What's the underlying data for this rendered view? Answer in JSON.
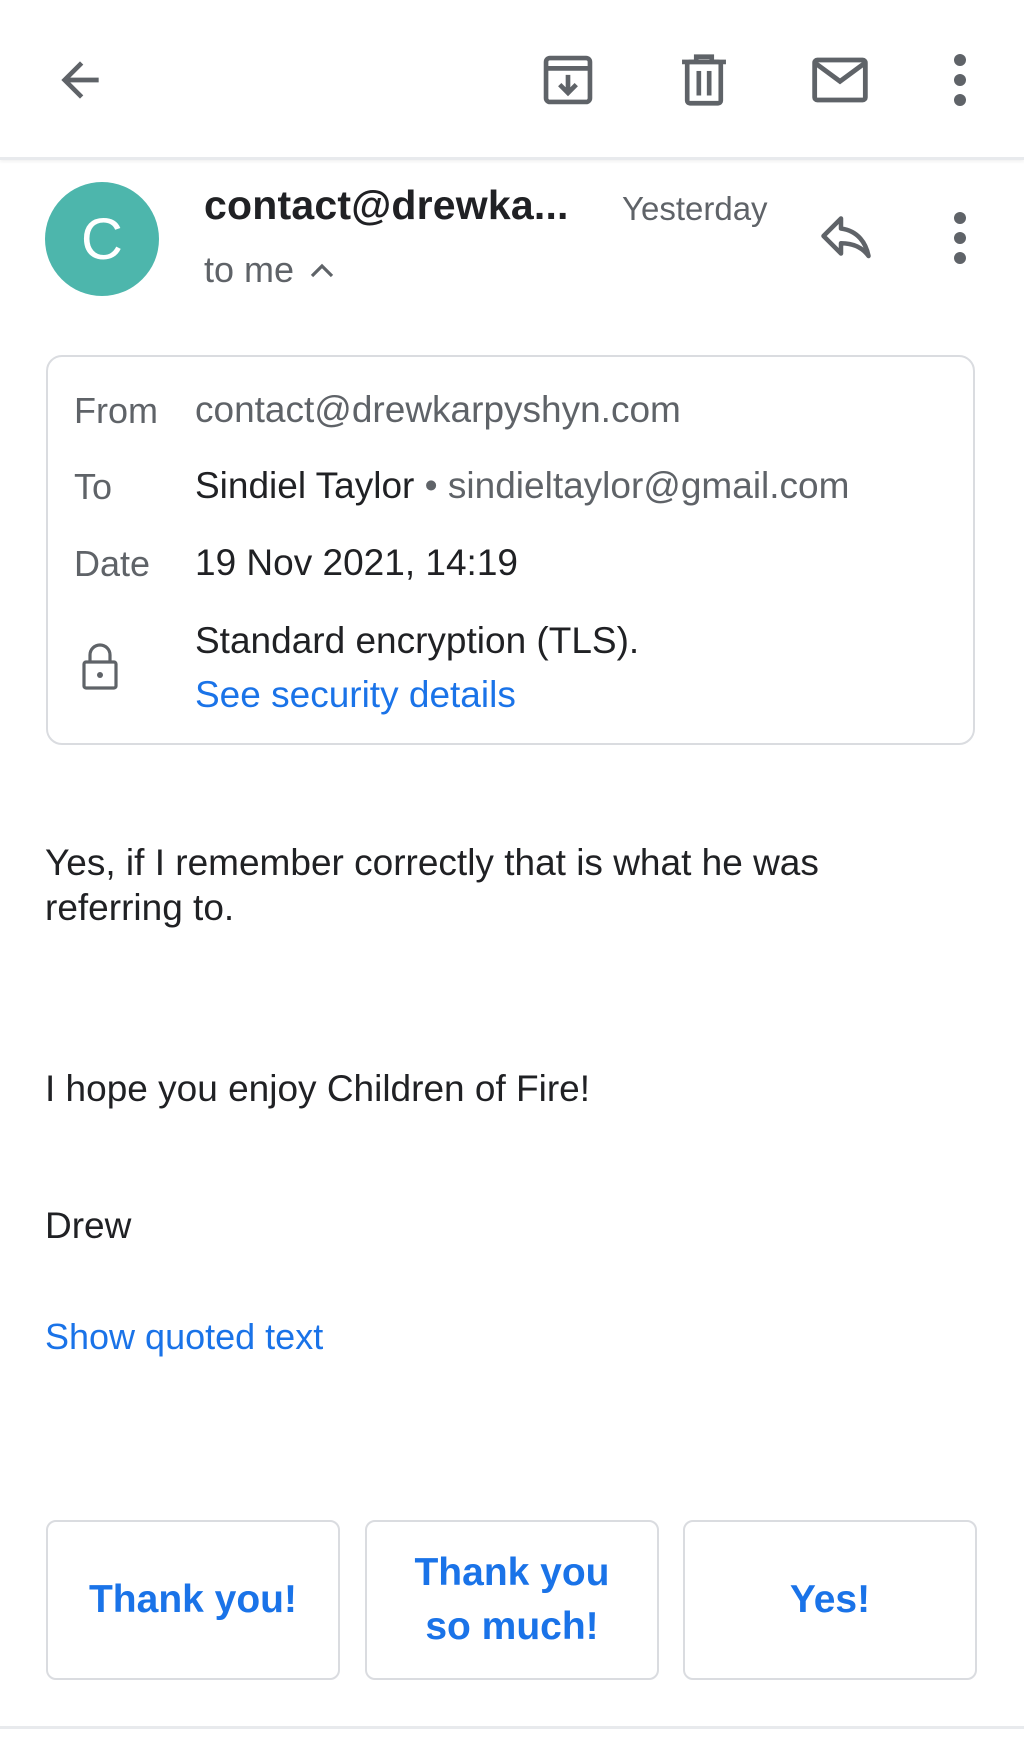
{
  "toolbar": {
    "back": "arrow-left-icon",
    "archive": "archive-icon",
    "delete": "trash-icon",
    "mark_unread": "mail-icon",
    "more": "more-vert-icon"
  },
  "header": {
    "avatar_letter": "C",
    "avatar_color": "#4db6ac",
    "sender": "contact@drewka...",
    "time": "Yesterday",
    "recipient_summary": "to me"
  },
  "details": {
    "from_label": "From",
    "from_value": "contact@drewkarpyshyn.com",
    "to_label": "To",
    "to_name": "Sindiel Taylor",
    "to_separator": "•",
    "to_email": "sindieltaylor@gmail.com",
    "date_label": "Date",
    "date_value": "19 Nov 2021, 14:19",
    "encryption": "Standard encryption (TLS).",
    "security_link": "See security details"
  },
  "body": {
    "paragraph1": "Yes, if I remember correctly that is what he was referring to.",
    "paragraph2": "I hope you enjoy Children of Fire!",
    "signature": "Drew",
    "show_quoted": "Show quoted text"
  },
  "smart_replies": [
    "Thank you!",
    "Thank you so much!",
    "Yes!"
  ],
  "colors": {
    "link": "#1a73e8",
    "text": "#202124",
    "muted": "#5f6368"
  }
}
